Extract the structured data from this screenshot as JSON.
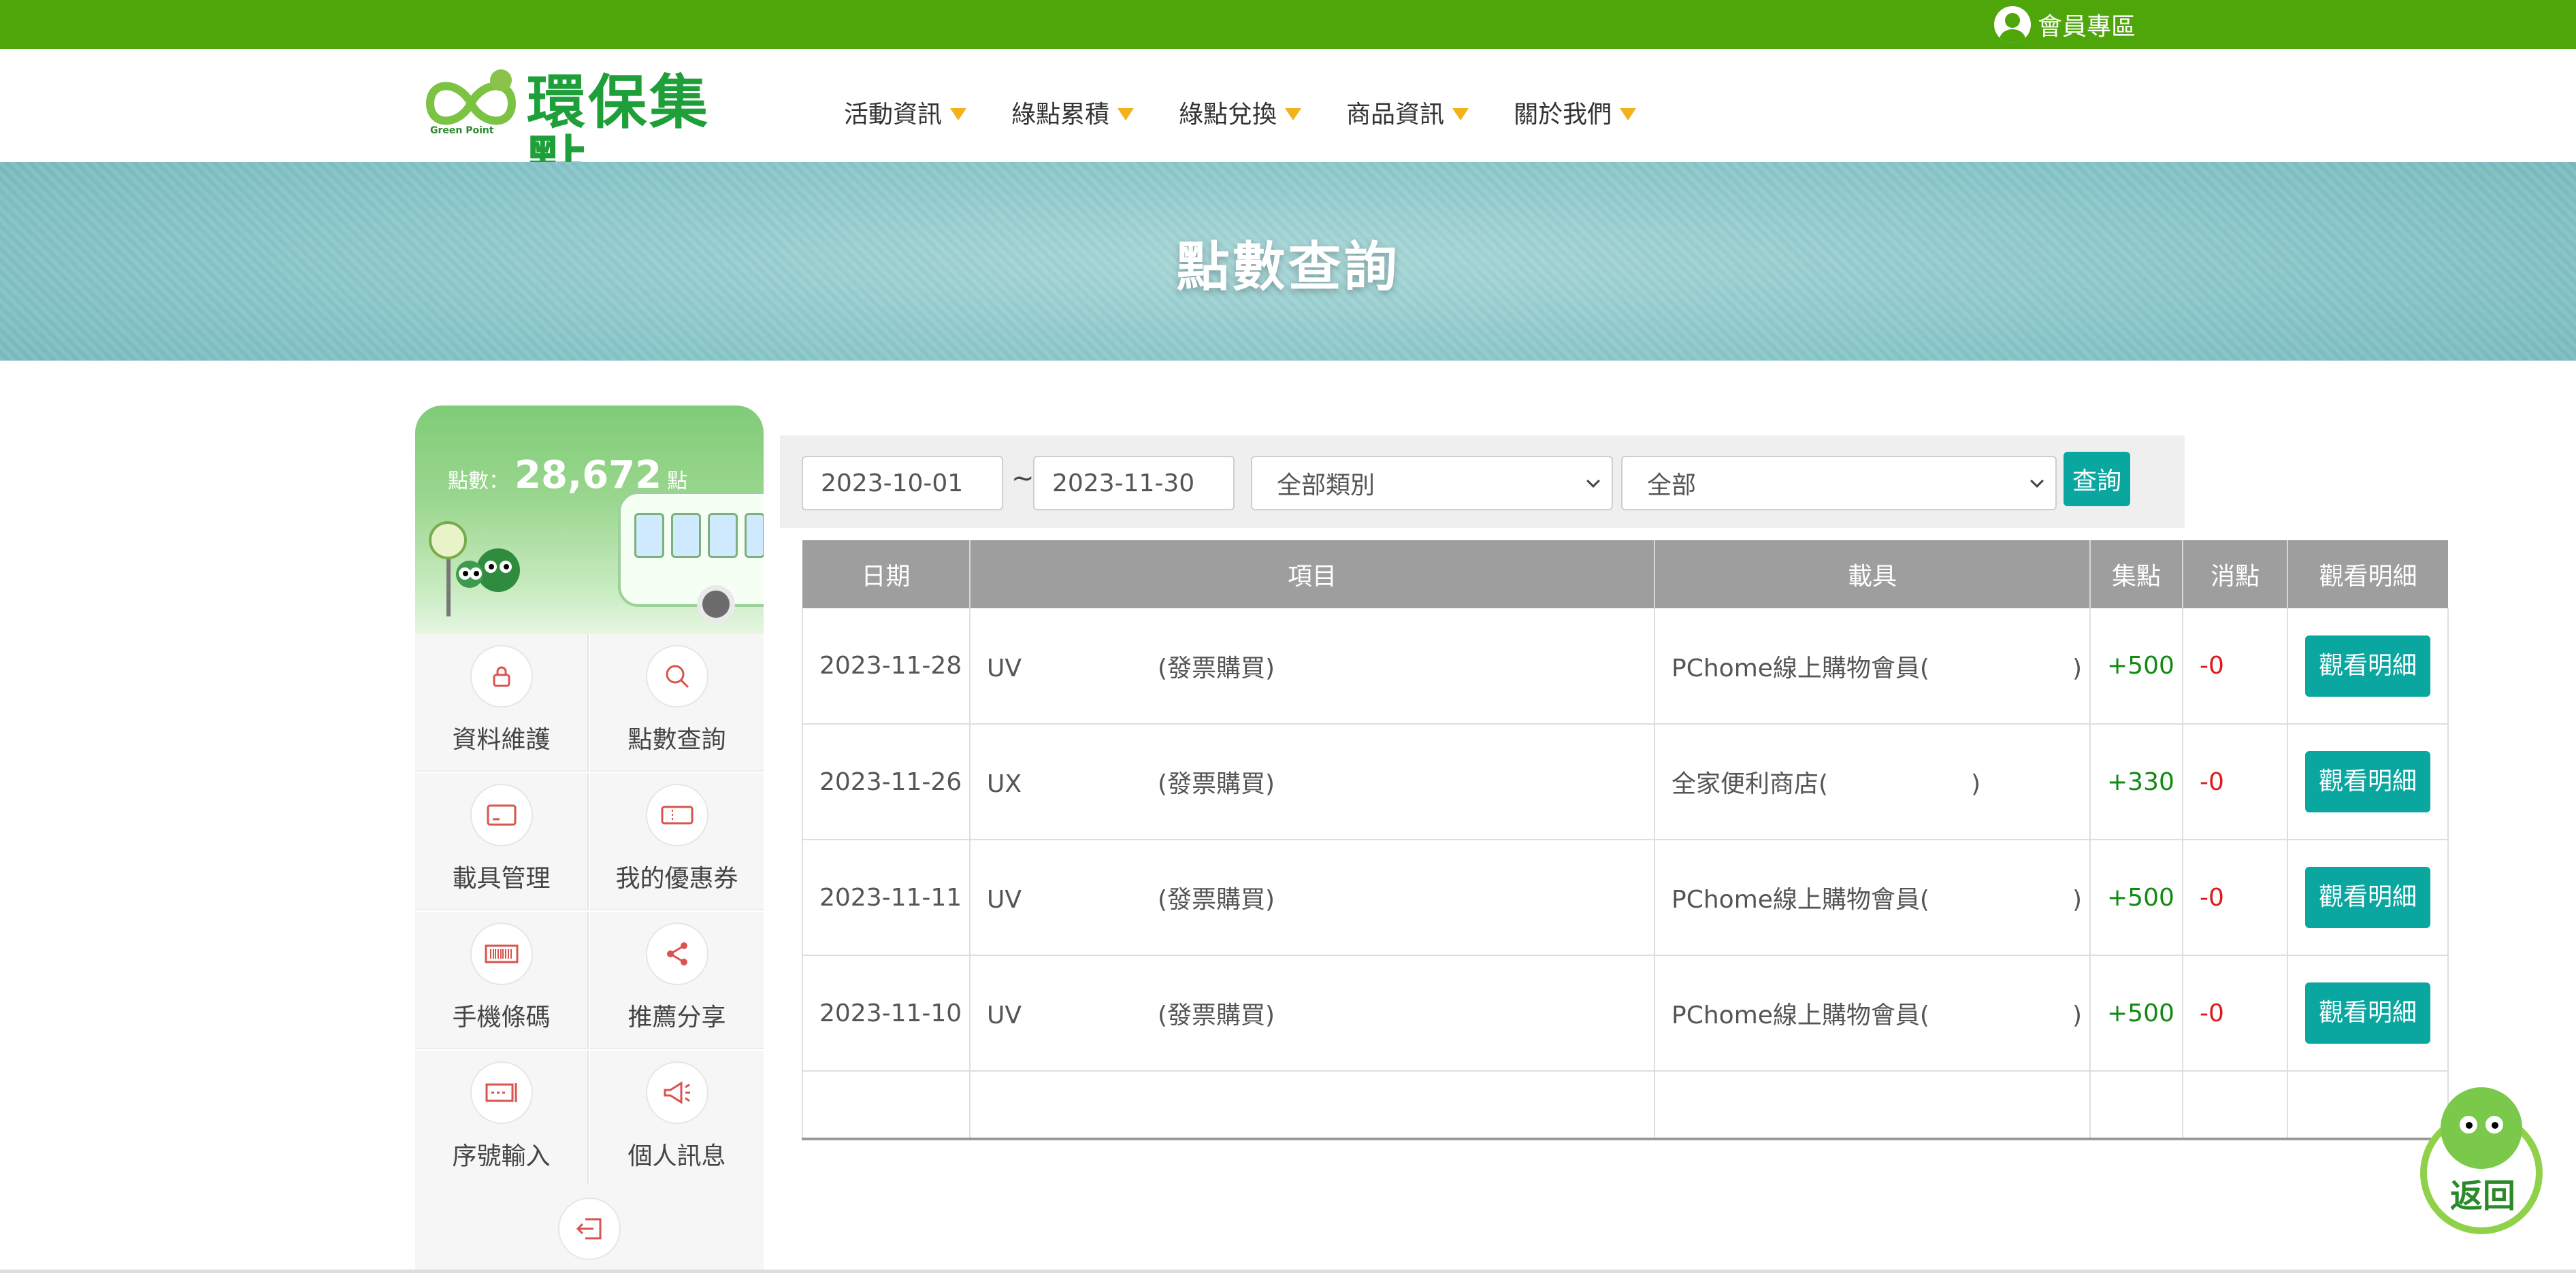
{
  "topbar": {
    "member_label": "會員專區"
  },
  "logo": {
    "text": "環保集點",
    "sub": "Green Point"
  },
  "nav": [
    {
      "label": "活動資訊"
    },
    {
      "label": "綠點累積"
    },
    {
      "label": "綠點兌換"
    },
    {
      "label": "商品資訊"
    },
    {
      "label": "關於我們"
    }
  ],
  "banner": {
    "title": "點數查詢"
  },
  "sidebar": {
    "points_label": "點數：",
    "points_value": "28,672",
    "points_unit": "點",
    "items": [
      {
        "label": "資料維護",
        "icon": "lock-icon"
      },
      {
        "label": "點數查詢",
        "icon": "search-icon"
      },
      {
        "label": "載具管理",
        "icon": "card-icon"
      },
      {
        "label": "我的優惠券",
        "icon": "ticket-icon"
      },
      {
        "label": "手機條碼",
        "icon": "barcode-icon"
      },
      {
        "label": "推薦分享",
        "icon": "share-icon"
      },
      {
        "label": "序號輸入",
        "icon": "serial-icon"
      },
      {
        "label": "個人訊息",
        "icon": "megaphone-icon"
      }
    ],
    "logout_icon": "logout-icon"
  },
  "filters": {
    "date_from": "2023-10-01",
    "date_to": "2023-11-30",
    "tilde": "~",
    "category": "全部類別",
    "scope": "全部",
    "query_label": "查詢"
  },
  "table": {
    "headers": [
      "日期",
      "項目",
      "載具",
      "集點",
      "消點",
      "觀看明細"
    ],
    "rows": [
      {
        "date": "2023-11-28",
        "item": "UV",
        "item_note": "(發票購買)",
        "carrier": "PChome線上購物會員(",
        "carrier_end": ")",
        "earn": "+500",
        "spend": "-0",
        "detail": "觀看明細"
      },
      {
        "date": "2023-11-26",
        "item": "UX",
        "item_note": "(發票購買)",
        "carrier": "全家便利商店(",
        "carrier_end": ")",
        "earn": "+330",
        "spend": "-0",
        "detail": "觀看明細"
      },
      {
        "date": "2023-11-11",
        "item": "UV",
        "item_note": "(發票購買)",
        "carrier": "PChome線上購物會員(",
        "carrier_end": ")",
        "earn": "+500",
        "spend": "-0",
        "detail": "觀看明細"
      },
      {
        "date": "2023-11-10",
        "item": "UV",
        "item_note": "(發票購買)",
        "carrier": "PChome線上購物會員(",
        "carrier_end": ")",
        "earn": "+500",
        "spend": "-0",
        "detail": "觀看明細"
      }
    ]
  },
  "back": {
    "label": "返回"
  },
  "colors": {
    "brand_green": "#4fa60a",
    "teal": "#0aa6a0",
    "header_gray": "#9e9e9e"
  }
}
